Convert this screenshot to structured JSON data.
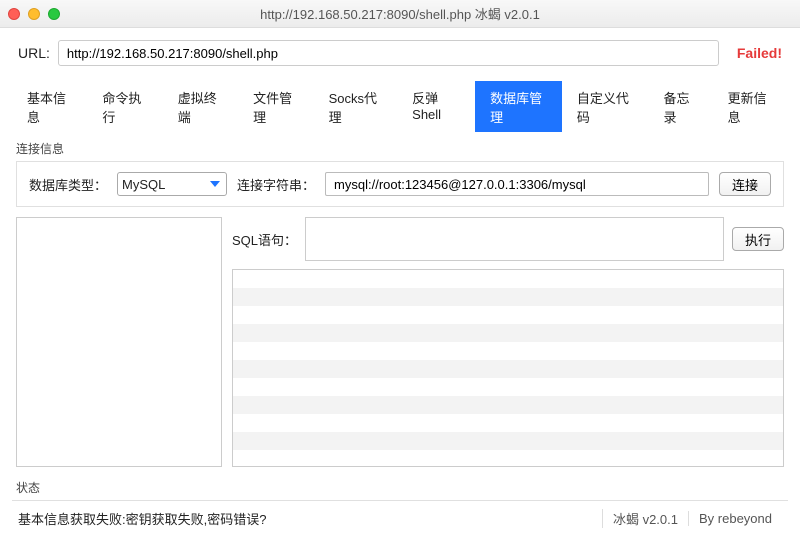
{
  "window": {
    "title": "http://192.168.50.217:8090/shell.php    冰蝎 v2.0.1"
  },
  "url_bar": {
    "label": "URL:",
    "value": "http://192.168.50.217:8090/shell.php",
    "status": "Failed!"
  },
  "tabs": [
    {
      "label": "基本信息",
      "active": false
    },
    {
      "label": "命令执行",
      "active": false
    },
    {
      "label": "虚拟终端",
      "active": false
    },
    {
      "label": "文件管理",
      "active": false
    },
    {
      "label": "Socks代理",
      "active": false
    },
    {
      "label": "反弹Shell",
      "active": false
    },
    {
      "label": "数据库管理",
      "active": true
    },
    {
      "label": "自定义代码",
      "active": false
    },
    {
      "label": "备忘录",
      "active": false
    },
    {
      "label": "更新信息",
      "active": false
    }
  ],
  "db": {
    "section_label": "连接信息",
    "type_label": "数据库类型：",
    "type_value": "MySQL",
    "conn_label": "连接字符串：",
    "conn_value": "mysql://root:123456@127.0.0.1:3306/mysql",
    "connect_btn": "连接",
    "sql_label": "SQL语句：",
    "sql_value": "",
    "exec_btn": "执行"
  },
  "status": {
    "section_label": "状态",
    "message": "基本信息获取失败:密钥获取失败,密码错误?",
    "version": "冰蝎 v2.0.1",
    "author": "By rebeyond"
  }
}
